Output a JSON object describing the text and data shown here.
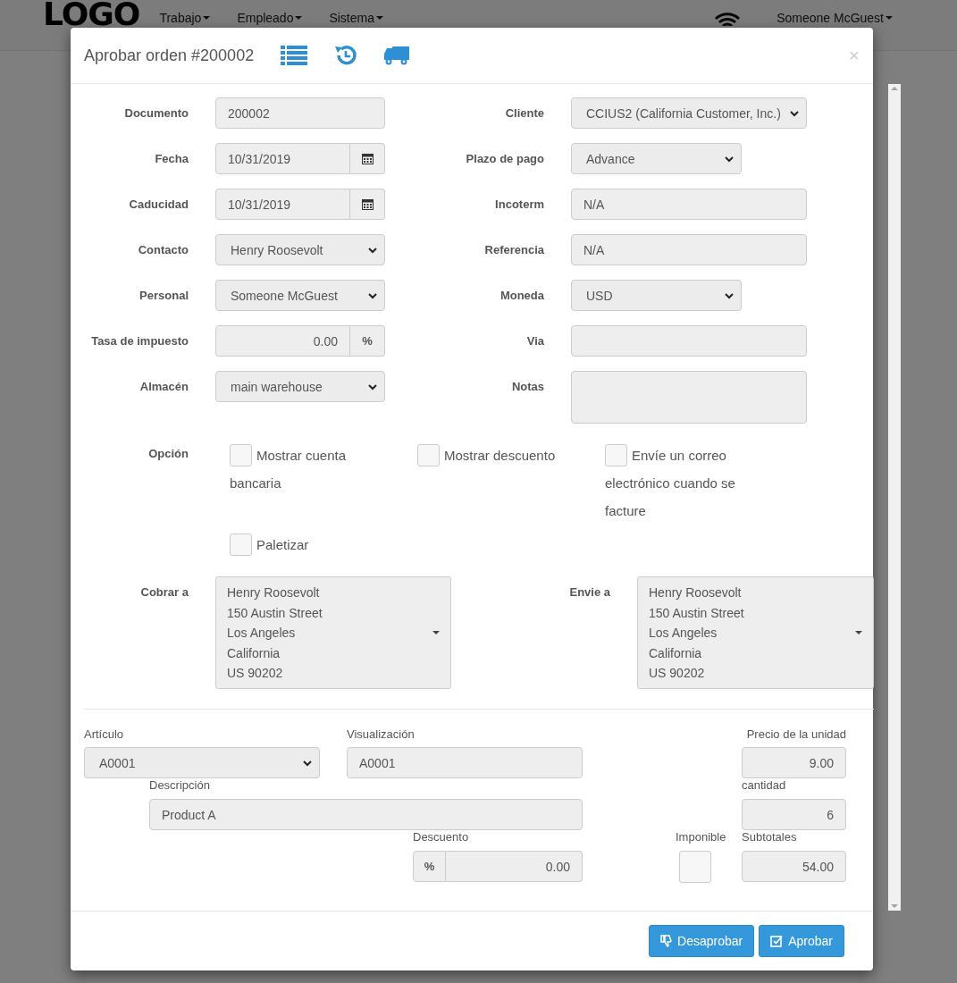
{
  "background": {
    "logo": "LOGO",
    "menu": [
      {
        "label": "Trabajo"
      },
      {
        "label": "Empleado"
      },
      {
        "label": "Sistema"
      }
    ],
    "user": "Someone McGuest"
  },
  "modal": {
    "title": "Aprobar orden #200002",
    "close": "×"
  },
  "form": {
    "rows": [
      {
        "left": {
          "label": "Documento",
          "kind": "text",
          "value": "200002"
        },
        "right": {
          "label": "Cliente",
          "kind": "select",
          "value": "CCIUS2 (California Customer, Inc.)"
        }
      },
      {
        "left": {
          "label": "Fecha",
          "kind": "date",
          "value": "10/31/2019"
        },
        "right": {
          "label": "Plazo de pago",
          "kind": "select-short",
          "value": "Advance"
        }
      },
      {
        "left": {
          "label": "Caducidad",
          "kind": "date",
          "value": "10/31/2019"
        },
        "right": {
          "label": "Incoterm",
          "kind": "text",
          "value": "N/A"
        }
      },
      {
        "left": {
          "label": "Contacto",
          "kind": "select",
          "value": "Henry Roosevolt"
        },
        "right": {
          "label": "Referencia",
          "kind": "text",
          "value": "N/A"
        }
      },
      {
        "left": {
          "label": "Personal",
          "kind": "select",
          "value": "Someone McGuest"
        },
        "right": {
          "label": "Moneda",
          "kind": "select-short",
          "value": "USD"
        }
      },
      {
        "left": {
          "label": "Tasa de impuesto",
          "kind": "percent",
          "value": "0.00",
          "addon": "%"
        },
        "right": {
          "label": "Via",
          "kind": "text"
        }
      },
      {
        "left": {
          "label": "Almacén",
          "kind": "select",
          "value": "main warehouse"
        },
        "right": {
          "label": "Notas",
          "kind": "textarea"
        }
      }
    ]
  },
  "options": {
    "label": "Opción",
    "items": [
      {
        "label": "Mostrar cuenta bancaria",
        "checked": false
      },
      {
        "label": "Mostrar descuento",
        "checked": false
      },
      {
        "label": "Envíe un correo electrónico cuando se facture",
        "checked": false
      },
      {
        "label": "Paletizar",
        "checked": false
      }
    ]
  },
  "addresses": [
    {
      "label": "Cobrar a",
      "lines": [
        "Henry Roosevolt",
        "150 Austin Street",
        "Los Angeles",
        "California",
        "US 90202"
      ]
    },
    {
      "label": "Envie a",
      "lines": [
        "Henry Roosevolt",
        "150 Austin Street",
        "Los Angeles",
        "California",
        "US 90202"
      ]
    }
  ],
  "item": {
    "article": {
      "label": "Artículo",
      "value": "A0001"
    },
    "display": {
      "label": "Visualización",
      "value": "A0001"
    },
    "unit_price": {
      "label": "Precio de la unidad",
      "value": "9.00"
    },
    "description": {
      "label": "Descripción",
      "value": "Product A"
    },
    "quantity": {
      "label": "cantidad",
      "value": "6"
    },
    "discount": {
      "label": "Descuento",
      "addon": "%",
      "value": "0.00"
    },
    "taxable": {
      "label": "Imponible",
      "checked": false
    },
    "subtotal": {
      "label": "Subtotales",
      "value": "54.00"
    }
  },
  "buttons": [
    {
      "label": "Desaprobar",
      "kind": "reject"
    },
    {
      "label": "Aprobar",
      "kind": "approve"
    }
  ]
}
